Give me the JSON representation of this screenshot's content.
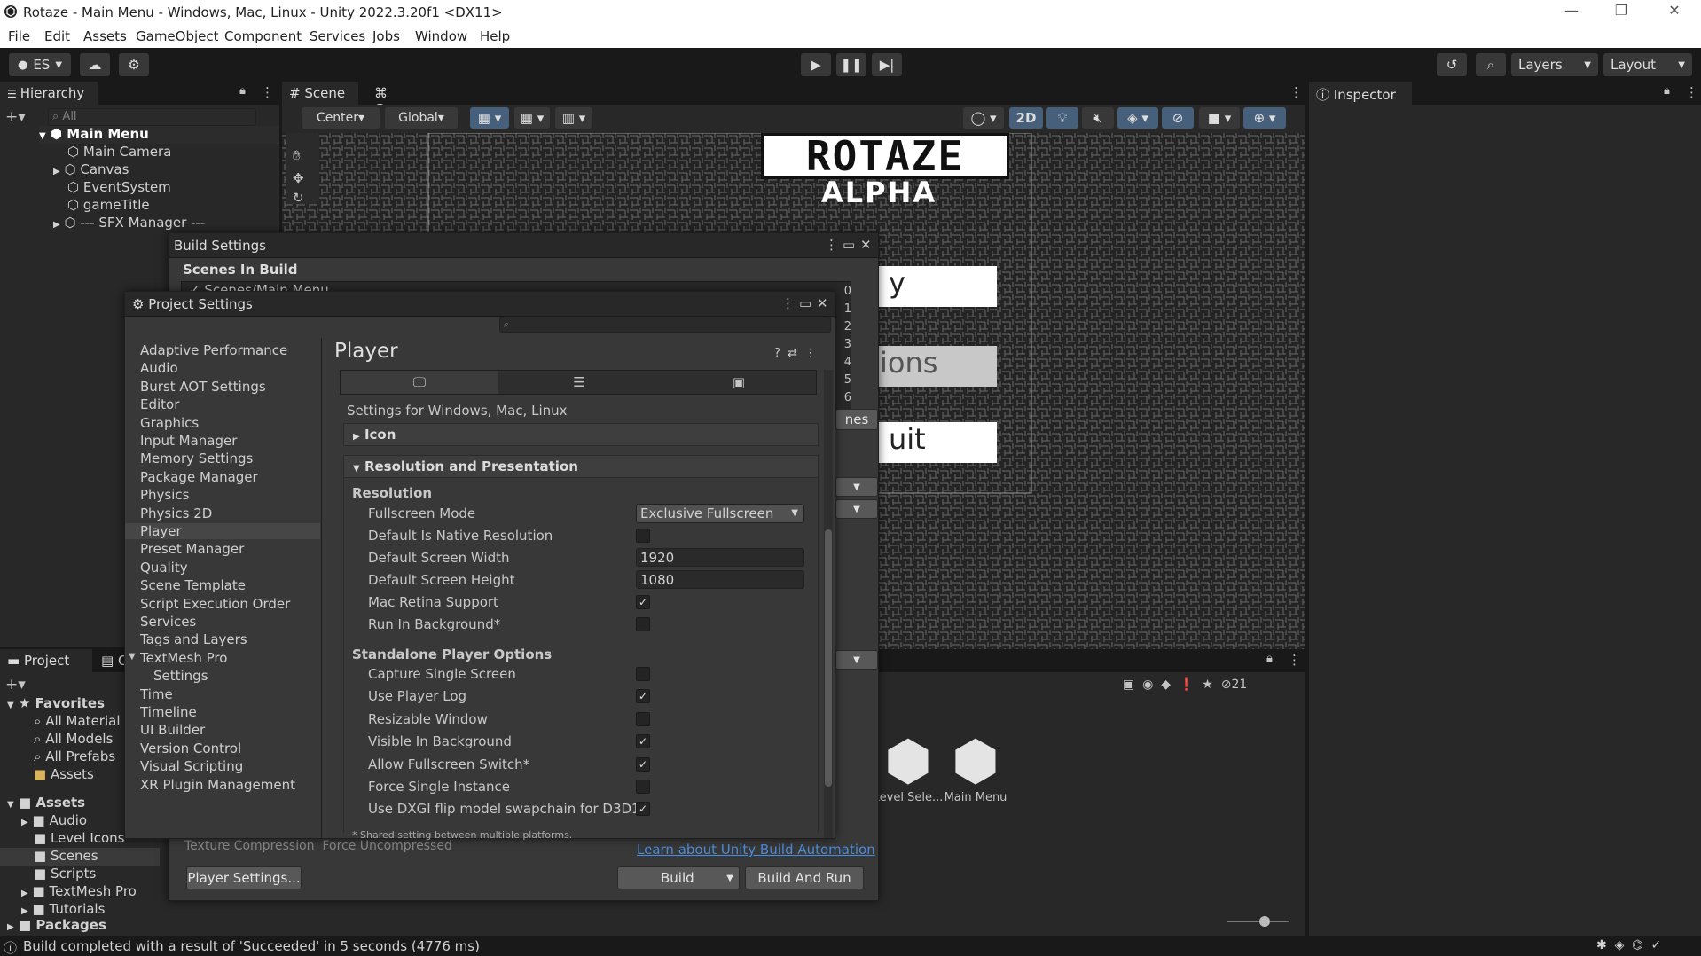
{
  "window": {
    "title": "Rotaze - Main Menu - Windows, Mac, Linux - Unity 2022.3.20f1 <DX11>",
    "min": "—",
    "max": "❐",
    "close": "✕"
  },
  "menu": [
    "File",
    "Edit",
    "Assets",
    "GameObject",
    "Component",
    "Services",
    "Jobs",
    "Window",
    "Help"
  ],
  "toolbar": {
    "account": "ES",
    "layers": "Layers",
    "layout": "Layout"
  },
  "hierarchy": {
    "tab": "Hierarchy",
    "search_placeholder": "All",
    "scene": "Main Menu",
    "items": [
      "Main Camera",
      "Canvas",
      "EventSystem",
      "gameTitle",
      "--- SFX Manager ---"
    ]
  },
  "scene_tabs": {
    "scene": "Scene",
    "game": "Game",
    "center": "Center",
    "global": "Global",
    "two_d": "2D"
  },
  "game_view": {
    "logo_line1": "ROTAZE",
    "logo_line2": "ALPHA",
    "btn1": "y",
    "btn2": "ions",
    "btn3": "uit"
  },
  "inspector": {
    "tab": "Inspector"
  },
  "build_settings": {
    "title": "Build Settings",
    "scenes_header": "Scenes In Build",
    "scene_row": "Scenes/Main Menu",
    "indices": [
      "0",
      "1",
      "2",
      "3",
      "4",
      "5",
      "6"
    ],
    "platforms_partial": "nes",
    "texture_compression": "Texture Compression",
    "force_uncompressed": "Force Uncompressed",
    "learn_link": "Learn about Unity Build Automation",
    "player_settings_btn": "Player Settings...",
    "build_btn": "Build",
    "build_and_run_btn": "Build And Run"
  },
  "project_settings": {
    "title": "Project Settings",
    "search_placeholder": "",
    "categories": [
      "Adaptive Performance",
      "Audio",
      "Burst AOT Settings",
      "Editor",
      "Graphics",
      "Input Manager",
      "Memory Settings",
      "Package Manager",
      "Physics",
      "Physics 2D",
      "Player",
      "Preset Manager",
      "Quality",
      "Scene Template",
      "Script Execution Order",
      "Services",
      "Tags and Layers",
      "TextMesh Pro",
      "Settings",
      "Time",
      "Timeline",
      "UI Builder",
      "Version Control",
      "Visual Scripting",
      "XR Plugin Management"
    ],
    "selected": "Player",
    "header": "Player",
    "platform_line": "Settings for Windows, Mac, Linux",
    "icon_section": "Icon",
    "res_section": "Resolution and Presentation",
    "resolution_header": "Resolution",
    "fullscreen_label": "Fullscreen Mode",
    "fullscreen_value": "Exclusive Fullscreen",
    "native_res_label": "Default Is Native Resolution",
    "width_label": "Default Screen Width",
    "width_value": "1920",
    "height_label": "Default Screen Height",
    "height_value": "1080",
    "retina_label": "Mac Retina Support",
    "background_label": "Run In Background*",
    "standalone_header": "Standalone Player Options",
    "options": [
      {
        "label": "Capture Single Screen",
        "checked": false
      },
      {
        "label": "Use Player Log",
        "checked": true
      },
      {
        "label": "Resizable Window",
        "checked": false
      },
      {
        "label": "Visible In Background",
        "checked": true
      },
      {
        "label": "Allow Fullscreen Switch*",
        "checked": true
      },
      {
        "label": "Force Single Instance",
        "checked": false
      },
      {
        "label": "Use DXGI flip model swapchain for D3D11",
        "checked": true
      }
    ],
    "footnote": "* Shared setting between multiple platforms."
  },
  "project": {
    "tab_project": "Project",
    "tab_console": "C",
    "favorites": "Favorites",
    "fav_items": [
      "All Material",
      "All Models",
      "All Prefabs",
      "Assets"
    ],
    "assets": "Assets",
    "asset_items": [
      "Audio",
      "Level Icons",
      "Scenes",
      "Scripts",
      "TextMesh Pro",
      "Tutorials"
    ],
    "packages": "Packages",
    "hidden_count": "21",
    "grid_items": [
      "Level Sele...",
      "Main Menu"
    ]
  },
  "status": {
    "message": "Build completed with a result of 'Succeeded' in 5 seconds (4776 ms)"
  },
  "check": "✓"
}
